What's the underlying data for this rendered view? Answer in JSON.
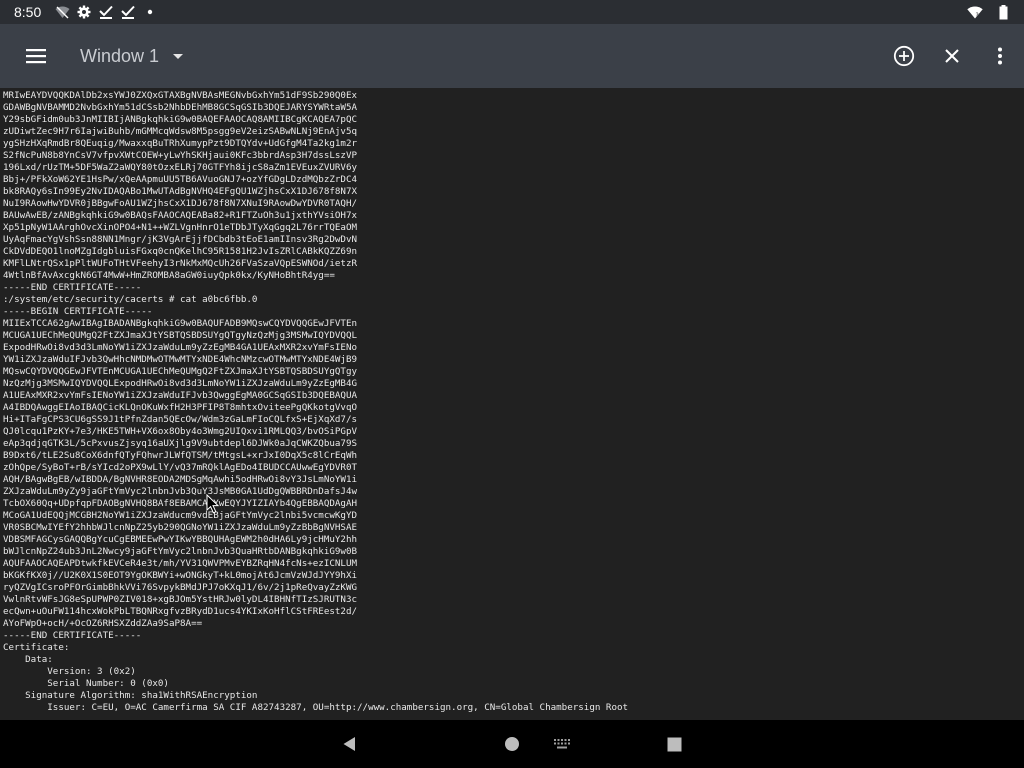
{
  "status_bar": {
    "time": "8:50",
    "icons_left": [
      "signal-off-icon",
      "gear-icon",
      "check-icon",
      "check-icon",
      "dot-icon"
    ],
    "icons_right": [
      "wifi-icon",
      "battery-icon"
    ]
  },
  "toolbar": {
    "title": "Window 1",
    "menu_icon": "hamburger-menu-icon",
    "dropdown_icon": "dropdown-caret-icon",
    "actions": [
      "add-window-icon",
      "close-icon",
      "more-vert-icon"
    ]
  },
  "terminal": {
    "lines": [
      "MRIwEAYDVQQKDAlDb2xsYWJ0ZXQxGTAXBgNVBAsMEGNvbGxhYm51dF9Sb290Q0Ex",
      "GDAWBgNVBAMMD2NvbGxhYm51dCSsb2NhbDEhMB8GCSqGSIb3DQEJARYSYWRtaW5A",
      "Y29sbGFidm0ub3JnMIIBIjANBgkqhkiG9w0BAQEFAAOCAQ8AMIIBCgKCAQEA7pQC",
      "zUDiwtZec9H7r6IajwiBuhb/mGMMcqWdsw8M5psgg9eV2eizSABwNLNj9EnAjv5q",
      "ygSHzHXqRmdBr8QEuqig/MwaxxqBuTRhXumypPzt9DTQYdv+UdGfgM4Ta2kg1m2r",
      "S2fNcPuN8b8YnCsV7vfpvXWtCOEW+yLwYhSKHjaui0KFc3bbrdAsp3H7dssLszVP",
      "196Lxd/rUzTM+5DF5WaZ2aWQY80tOzxELRj70GTFYh8ijcS8aZm1EVEuxZVURV6y",
      "Bbj+/PFkXoW62YE1HsPw/xQeAApmuUU5TB6AVuoGNJ7+ozYfGDgLDzdMQbzZrDC4",
      "bk8RAQy6sIn99Ey2NvIDAQABo1MwUTAdBgNVHQ4EFgQU1WZjhsCxX1DJ678f8N7X",
      "NuI9RAowHwYDVR0jBBgwFoAU1WZjhsCxX1DJ678f8N7XNuI9RAowDwYDVR0TAQH/",
      "BAUwAwEB/zANBgkqhkiG9w0BAQsFAAOCAQEABa82+R1FTZuOh3u1jxthYVsiOH7x",
      "Xp51pNyW1AArghOvcXinOPO4+N1++WZLVgnHnrO1eTDbJTyXqGgq2L76rrTQEaOM",
      "UyAqFmacYgVshSsn88NN1Mngr/jK3VgArEjjfDCbdb3tEoE1amIInsv3Rg2DwDvN",
      "CkDVdDEQO1lnoMZgIdgbluisFGxq0cnQKelhC95R1581H2JvIsZRlCABkKQZZ69n",
      "KMFlLNtrQSx1pPltWUFoTHtVFeehyI3rNkMxMQcUh26FVaSzaVQpESWNOd/ietzR",
      "4WtlnBfAvAxcgkN6GT4MwW+HmZROMBA8aGW0iuyQpk0kx/KyNHoBhtR4yg==",
      "-----END CERTIFICATE-----",
      ":/system/etc/security/cacerts # cat a0bc6fbb.0",
      "-----BEGIN CERTIFICATE-----",
      "MIIExTCCA62gAwIBAgIBADANBgkqhkiG9w0BAQUFADB9MQswCQYDVQQGEwJFVTEn",
      "MCUGA1UEChMeQUMgQ2FtZXJmaXJtYSBTQSBDSUYgQTgyNzQzMjg3MSMwIQYDVQQL",
      "ExpodHRwOi8vd3d3LmNoYW1iZXJzaWduLm9yZzEgMB4GA1UEAxMXR2xvYmFsIENo",
      "YW1iZXJzaWduIFJvb3QwHhcNMDMwOTMwMTYxNDE4WhcNMzcwOTMwMTYxNDE4WjB9",
      "MQswCQYDVQQGEwJFVTEnMCUGA1UEChMeQUMgQ2FtZXJmaXJtYSBTQSBDSUYgQTgy",
      "NzQzMjg3MSMwIQYDVQQLExpodHRwOi8vd3d3LmNoYW1iZXJzaWduLm9yZzEgMB4G",
      "A1UEAxMXR2xvYmFsIENoYW1iZXJzaWduIFJvb3QwggEgMA0GCSqGSIb3DQEBAQUA",
      "A4IBDQAwggEIAoIBAQCicKLQnOKuWxfH2H3PFIP8T8mhtxOviteePgQKkotgVvqO",
      "Hi+ITaFgCPS3CU6gSS9J1tPfnZdan5QEcOw/Wdm3zGaLmFIoCQLfxS+EjXqXd7/s",
      "QJ0lcqu1PzKY+7e3/HKE5TWH+VX6ox8Oby4o3Wmg2UIQxvi1RMLQQ3/bvOSiPGpV",
      "eAp3qdjqGTK3L/5cPxvusZjsyq16aUXjlg9V9ubtdepl6DJWk0aJqCWKZQbua79S",
      "B9Dxt6/tLE2Su8CoX6dnfQTyFQhwrJLWfQTSM/tMtgsL+xrJxI0DqX5c8lCrEqWh",
      "zOhQpe/SyBoT+rB/sYIcd2oPX9wLlY/vQ37mRQklAgEDo4IBUDCCAUwwEgYDVR0T",
      "AQH/BAgwBgEB/wIBDDA/BgNVHR8EODA2MDSgMqAwhi5odHRwOi8vY3JsLmNoYW1i",
      "ZXJzaWduLm9yZy9jaGFtYmVyc2lnbnJvb3QuY3JsMB0GA1UdDgQWBBRDnDafsJ4w",
      "TcbOX60Qq+UDpfqpFDAOBgNVHQ8BAf8EBAMCAQYwEQYJYIZIAYb4QgEBBAQDAgAH",
      "MCoGA1UdEQQjMCGBH2NoYW1iZXJzaWducm9vdEBjaGFtYmVyc2lnbi5vcmcwKgYD",
      "VR0SBCMwIYEfY2hhbWJlcnNpZ25yb290QGNoYW1iZXJzaWduLm9yZzBbBgNVHSAE",
      "VDBSMFAGCysGAQQBgYcuCgEBMEEwPwYIKwYBBQUHAgEWM2h0dHA6Ly9jcHMuY2hh",
      "bWJlcnNpZ24ub3JnL2Nwcy9jaGFtYmVyc2lnbnJvb3QuaHRtbDANBgkqhkiG9w0B",
      "AQUFAAOCAQEAPDtwkfkEVCeR4e3t/mh/YV31QWVPMvEYBZRqHN4fcNs+ezICNLUM",
      "bKGKfKX0j//U2K0X1S0EOT9YgOKBWYi+wONGkyT+kL0mojAt6JcmVzWJdJYY9hXi",
      "ryQZVgICsroPFOrGimbBhkVVi76SvpykBMdJPJ7oKXqJ1/6v/2j1pReQvayZzKWG",
      "VwlnRtvWFsJG8eSpUPWP0ZIV018+xgBJOm5YstHRJw0lyDL4IBHNfTIzSJRUTN3c",
      "ecQwn+uOuFW114hcxWokPbLTBQNRxgfvzBRydD1ucs4YKIxKoHflCStFREest2d/",
      "AYoFWpO+ocH/+OcOZ6RHSXZddZAa9SaP8A==",
      "-----END CERTIFICATE-----",
      "Certificate:",
      "    Data:",
      "        Version: 3 (0x2)",
      "        Serial Number: 0 (0x0)",
      "    Signature Algorithm: sha1WithRSAEncryption",
      "        Issuer: C=EU, O=AC Camerfirma SA CIF A82743287, OU=http://www.chambersign.org, CN=Global Chambersign Root"
    ]
  },
  "nav_bar": {
    "buttons": [
      "back-icon",
      "home-icon",
      "keyboard-icon",
      "recents-icon"
    ]
  }
}
